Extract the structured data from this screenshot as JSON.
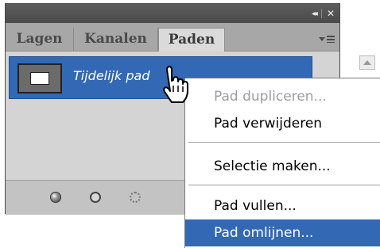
{
  "panel": {
    "tabs": [
      {
        "label": "Lagen",
        "active": false
      },
      {
        "label": "Kanalen",
        "active": false
      },
      {
        "label": "Paden",
        "active": true
      }
    ],
    "titlebar": {
      "collapse_icon": "double-chevron-left-icon",
      "collapse_glyph": "◂◂",
      "close_icon": "close-icon",
      "close_glyph": "✕"
    },
    "menu_icon": "panel-menu-icon",
    "paths": [
      {
        "name": "Tijdelijk pad",
        "selected": true
      }
    ],
    "bottom_buttons": [
      {
        "icon": "fill-path-icon"
      },
      {
        "icon": "stroke-path-icon"
      },
      {
        "icon": "load-selection-icon"
      }
    ]
  },
  "context_menu": {
    "items": [
      {
        "label": "Pad dupliceren...",
        "disabled": true
      },
      {
        "label": "Pad verwijderen",
        "disabled": false
      },
      {
        "label": "Selectie maken...",
        "disabled": false
      },
      {
        "label": "Pad vullen...",
        "disabled": false
      },
      {
        "label": "Pad omlijnen...",
        "disabled": false,
        "highlighted": true
      }
    ]
  },
  "colors": {
    "selection_blue": "#3368b4",
    "panel_gray": "#c9c9c9",
    "title_dark": "#4a4a4a"
  }
}
